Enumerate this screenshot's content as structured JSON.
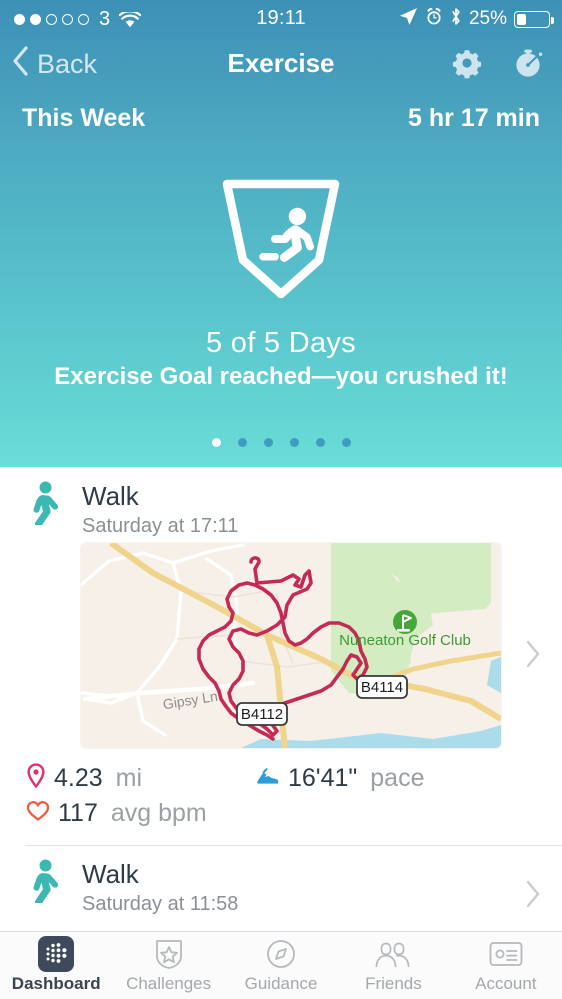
{
  "status_bar": {
    "signal_dots_total": 5,
    "signal_dots_filled": 2,
    "carrier": "3",
    "wifi_icon": "wifi-icon",
    "time": "19:11",
    "location_icon": "location-arrow-icon",
    "alarm_icon": "alarm-clock-icon",
    "bluetooth_icon": "bluetooth-icon",
    "battery_percent": "25%",
    "battery_level": 25
  },
  "nav": {
    "back_label": "Back",
    "back_icon": "chevron-left-icon",
    "title": "Exercise",
    "settings_icon": "gear-icon",
    "stopwatch_icon": "stopwatch-icon"
  },
  "summary": {
    "period_label": "This Week",
    "total_time": "5 hr 17 min",
    "badge_icon": "running-person-shield-icon",
    "goal_days": "5 of 5 Days",
    "goal_message": "Exercise Goal reached—you crushed it!",
    "pager": {
      "count": 6,
      "active_index": 0
    },
    "gradient_top": "#3c90b6",
    "gradient_bottom": "#6bdcd7"
  },
  "exercises": [
    {
      "icon": "walking-person-icon",
      "title": "Walk",
      "subtitle": "Saturday at 17:11",
      "chevron_icon": "chevron-right-icon",
      "map": {
        "route_color": "#c42a54",
        "poi_label": "Nuneaton Golf Club",
        "poi_icon": "golf-flag-icon",
        "street_label": "Gipsy Ln",
        "road_shields": [
          "B4112",
          "B4114"
        ],
        "background_color": "#f6f0e8",
        "park_color": "#cfe8bd",
        "water_color": "#a9d8e8",
        "road_color": "#f5d98a"
      },
      "stats": [
        {
          "icon": "map-pin-icon",
          "icon_color": "#e0316f",
          "value": "4.23",
          "unit": "mi"
        },
        {
          "icon": "running-shoe-icon",
          "icon_color": "#2d9cdb",
          "value": "16'41\"",
          "unit": "pace"
        },
        {
          "icon": "heart-icon",
          "icon_color": "#f05a3c",
          "value": "117",
          "unit": "avg bpm"
        }
      ]
    },
    {
      "icon": "walking-person-icon",
      "title": "Walk",
      "subtitle": "Saturday at 11:58",
      "chevron_icon": "chevron-right-icon"
    }
  ],
  "tabbar": {
    "items": [
      {
        "label": "Dashboard",
        "icon": "fitbit-dots-icon",
        "active": true
      },
      {
        "label": "Challenges",
        "icon": "star-shield-icon",
        "active": false
      },
      {
        "label": "Guidance",
        "icon": "compass-icon",
        "active": false
      },
      {
        "label": "Friends",
        "icon": "people-icon",
        "active": false
      },
      {
        "label": "Account",
        "icon": "id-card-icon",
        "active": false
      }
    ]
  }
}
